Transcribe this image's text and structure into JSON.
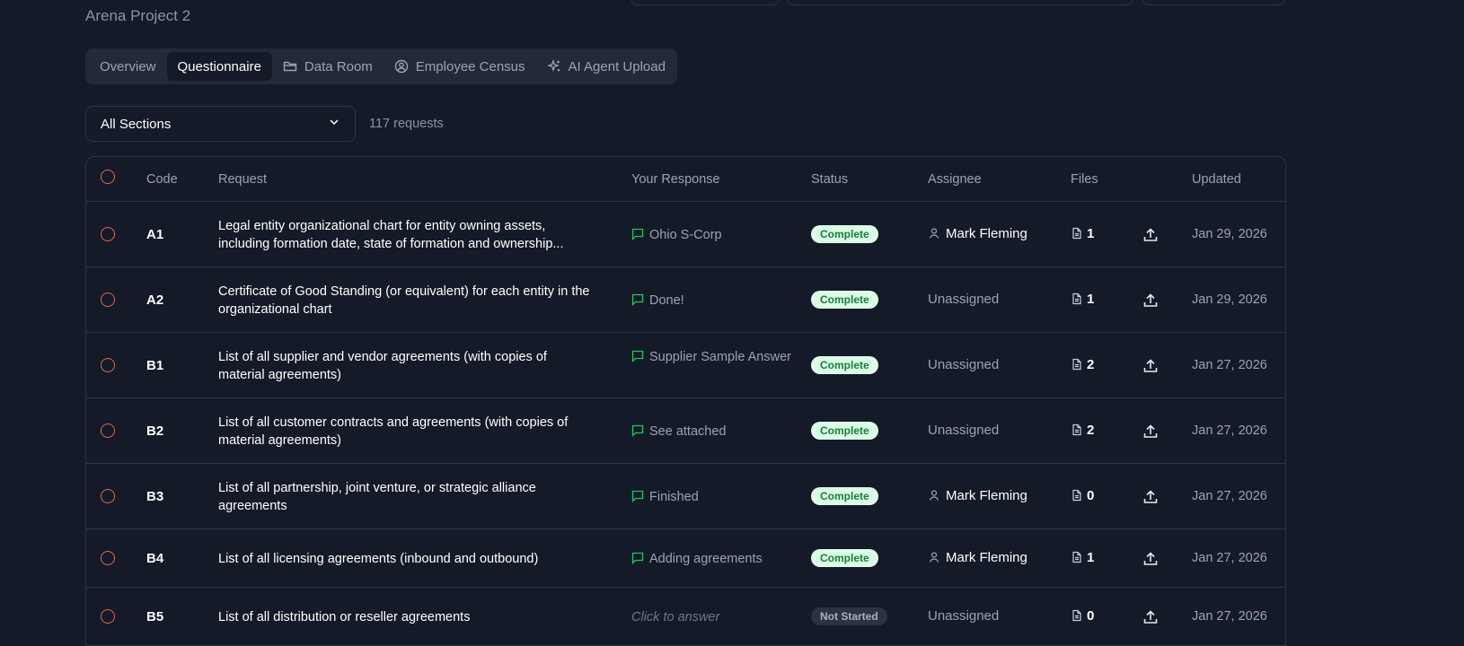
{
  "project": {
    "name": "Arena Project 2"
  },
  "tabs": [
    {
      "label": "Overview",
      "icon": "",
      "active": false
    },
    {
      "label": "Questionnaire",
      "icon": "",
      "active": true
    },
    {
      "label": "Data Room",
      "icon": "folder-icon",
      "active": false
    },
    {
      "label": "Employee Census",
      "icon": "user-circle-icon",
      "active": false
    },
    {
      "label": "AI Agent Upload",
      "icon": "sparkles-icon",
      "active": false
    }
  ],
  "filter": {
    "selected": "All Sections",
    "count_text": "117 requests"
  },
  "table": {
    "headers": {
      "code": "Code",
      "request": "Request",
      "response": "Your Response",
      "status": "Status",
      "assignee": "Assignee",
      "files": "Files",
      "updated": "Updated"
    },
    "rows": [
      {
        "code": "A1",
        "request": "Legal entity organizational chart for entity owning assets, including formation date, state of formation and ownership...",
        "response": "Ohio S-Corp",
        "status": "Complete",
        "assignee": "Mark Fleming",
        "files": "1",
        "updated": "Jan 29, 2026"
      },
      {
        "code": "A2",
        "request": "Certificate of Good Standing (or equivalent) for each entity in the organizational chart",
        "response": "Done!",
        "status": "Complete",
        "assignee": "Unassigned",
        "files": "1",
        "updated": "Jan 29, 2026"
      },
      {
        "code": "B1",
        "request": "List of all supplier and vendor agreements (with copies of material agreements)",
        "response": "Supplier Sample Answer",
        "status": "Complete",
        "assignee": "Unassigned",
        "files": "2",
        "updated": "Jan 27, 2026"
      },
      {
        "code": "B2",
        "request": "List of all customer contracts and agreements (with copies of material agreements)",
        "response": "See attached",
        "status": "Complete",
        "assignee": "Unassigned",
        "files": "2",
        "updated": "Jan 27, 2026"
      },
      {
        "code": "B3",
        "request": "List of all partnership, joint venture, or strategic alliance agreements",
        "response": "Finished",
        "status": "Complete",
        "assignee": "Mark Fleming",
        "files": "0",
        "updated": "Jan 27, 2026"
      },
      {
        "code": "B4",
        "request": "List of all licensing agreements (inbound and outbound)",
        "response": "Adding agreements",
        "status": "Complete",
        "assignee": "Mark Fleming",
        "files": "1",
        "updated": "Jan 27, 2026"
      },
      {
        "code": "B5",
        "request": "List of all distribution or reseller agreements",
        "response": "Click to answer",
        "status": "Not Started",
        "assignee": "Unassigned",
        "files": "0",
        "updated": "Jan 27, 2026"
      }
    ]
  },
  "colors": {
    "background": "#141a27",
    "accent_complete": "#15803d",
    "checkbox_outline": "#e2694a",
    "response_icon": "#22c55e"
  }
}
